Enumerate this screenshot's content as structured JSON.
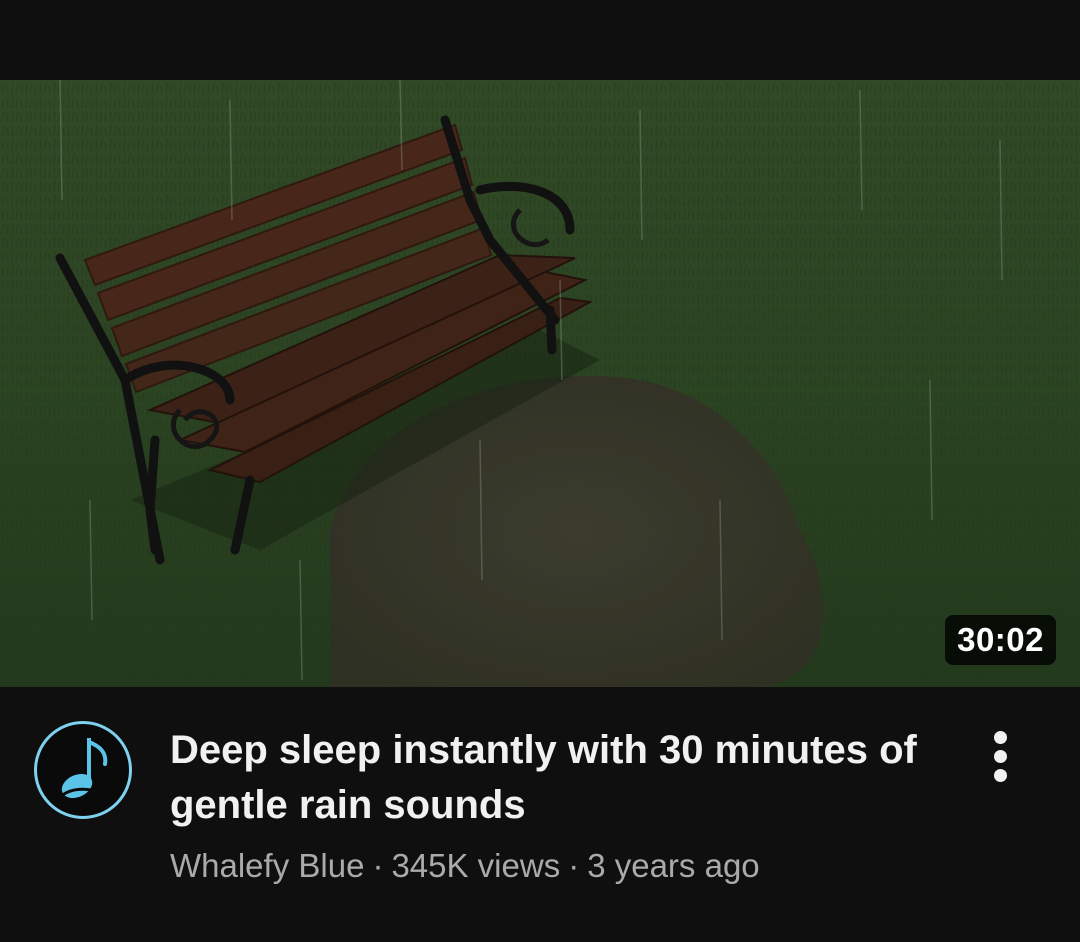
{
  "video": {
    "duration": "30:02",
    "title": "Deep sleep instantly with 30 minutes of gentle rain sounds",
    "channel": "Whalefy Blue",
    "separator": "·",
    "views": "345K views",
    "age": "3 years ago"
  },
  "icons": {
    "avatar": "music-note-icon",
    "menu": "more-vertical-icon"
  },
  "colors": {
    "background": "#0f0f0f",
    "avatar_ring": "#7fd1f0",
    "title_text": "#f1f1f1",
    "meta_text": "#aaaaaa"
  }
}
